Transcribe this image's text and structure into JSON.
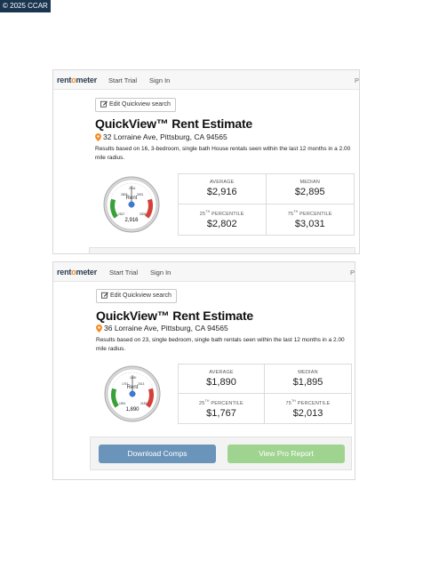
{
  "copyright": "© 2025 CCAR",
  "colors": {
    "brand_dark": "#2c3e50",
    "brand_orange": "#f28c28",
    "download_button": "#6a94b9",
    "pro_report_button": "#9fd490",
    "gauge_green": "#3aa03a",
    "gauge_red": "#d6403a",
    "pin": "#f28c28"
  },
  "panels": [
    {
      "nav": {
        "logo_pre": "rent",
        "logo_o": "o",
        "logo_post": "meter",
        "start_trial": "Start Trial",
        "sign_in": "Sign In",
        "cut_text": "P"
      },
      "edit_button": "Edit Quickview search",
      "title": "QuickView™ Rent Estimate",
      "address": "32 Lorraine Ave, Pittsburg, CA 94565",
      "description": "Results based on 16, 3-bedroom, single bath House rentals seen within the last 12 months in a 2.00 mile radius.",
      "gauge": {
        "label": "Rent",
        "value": "2,916",
        "ticks": [
          "2802",
          "3031",
          "2916",
          "2527",
          "3305"
        ]
      },
      "stats": {
        "average_label": "AVERAGE",
        "average": "$2,916",
        "median_label": "MEDIAN",
        "median": "$2,895",
        "p25_num": "25",
        "p25_suffix": "TH",
        "p25_word": "PERCENTILE",
        "p25": "$2,802",
        "p75_num": "75",
        "p75_suffix": "TH",
        "p75_word": "PERCENTILE",
        "p75": "$3,031"
      }
    },
    {
      "nav": {
        "logo_pre": "rent",
        "logo_o": "o",
        "logo_post": "meter",
        "start_trial": "Start Trial",
        "sign_in": "Sign In",
        "cut_text": "P"
      },
      "edit_button": "Edit Quickview search",
      "title": "QuickView™ Rent Estimate",
      "address": "36 Lorraine Ave, Pittsburg, CA 94565",
      "description": "Results based on 23, single bedroom, single bath rentals seen within the last 12 months in a 2.00 mile radius.",
      "gauge": {
        "label": "Rent",
        "value": "1,890",
        "ticks": [
          "1767",
          "2013",
          "1890",
          "1591",
          "2183"
        ]
      },
      "stats": {
        "average_label": "AVERAGE",
        "average": "$1,890",
        "median_label": "MEDIAN",
        "median": "$1,895",
        "p25_num": "25",
        "p25_suffix": "TH",
        "p25_word": "PERCENTILE",
        "p25": "$1,767",
        "p75_num": "75",
        "p75_suffix": "TH",
        "p75_word": "PERCENTILE",
        "p75": "$2,013"
      },
      "actions": {
        "download": "Download Comps",
        "pro_report": "View Pro Report"
      }
    }
  ]
}
